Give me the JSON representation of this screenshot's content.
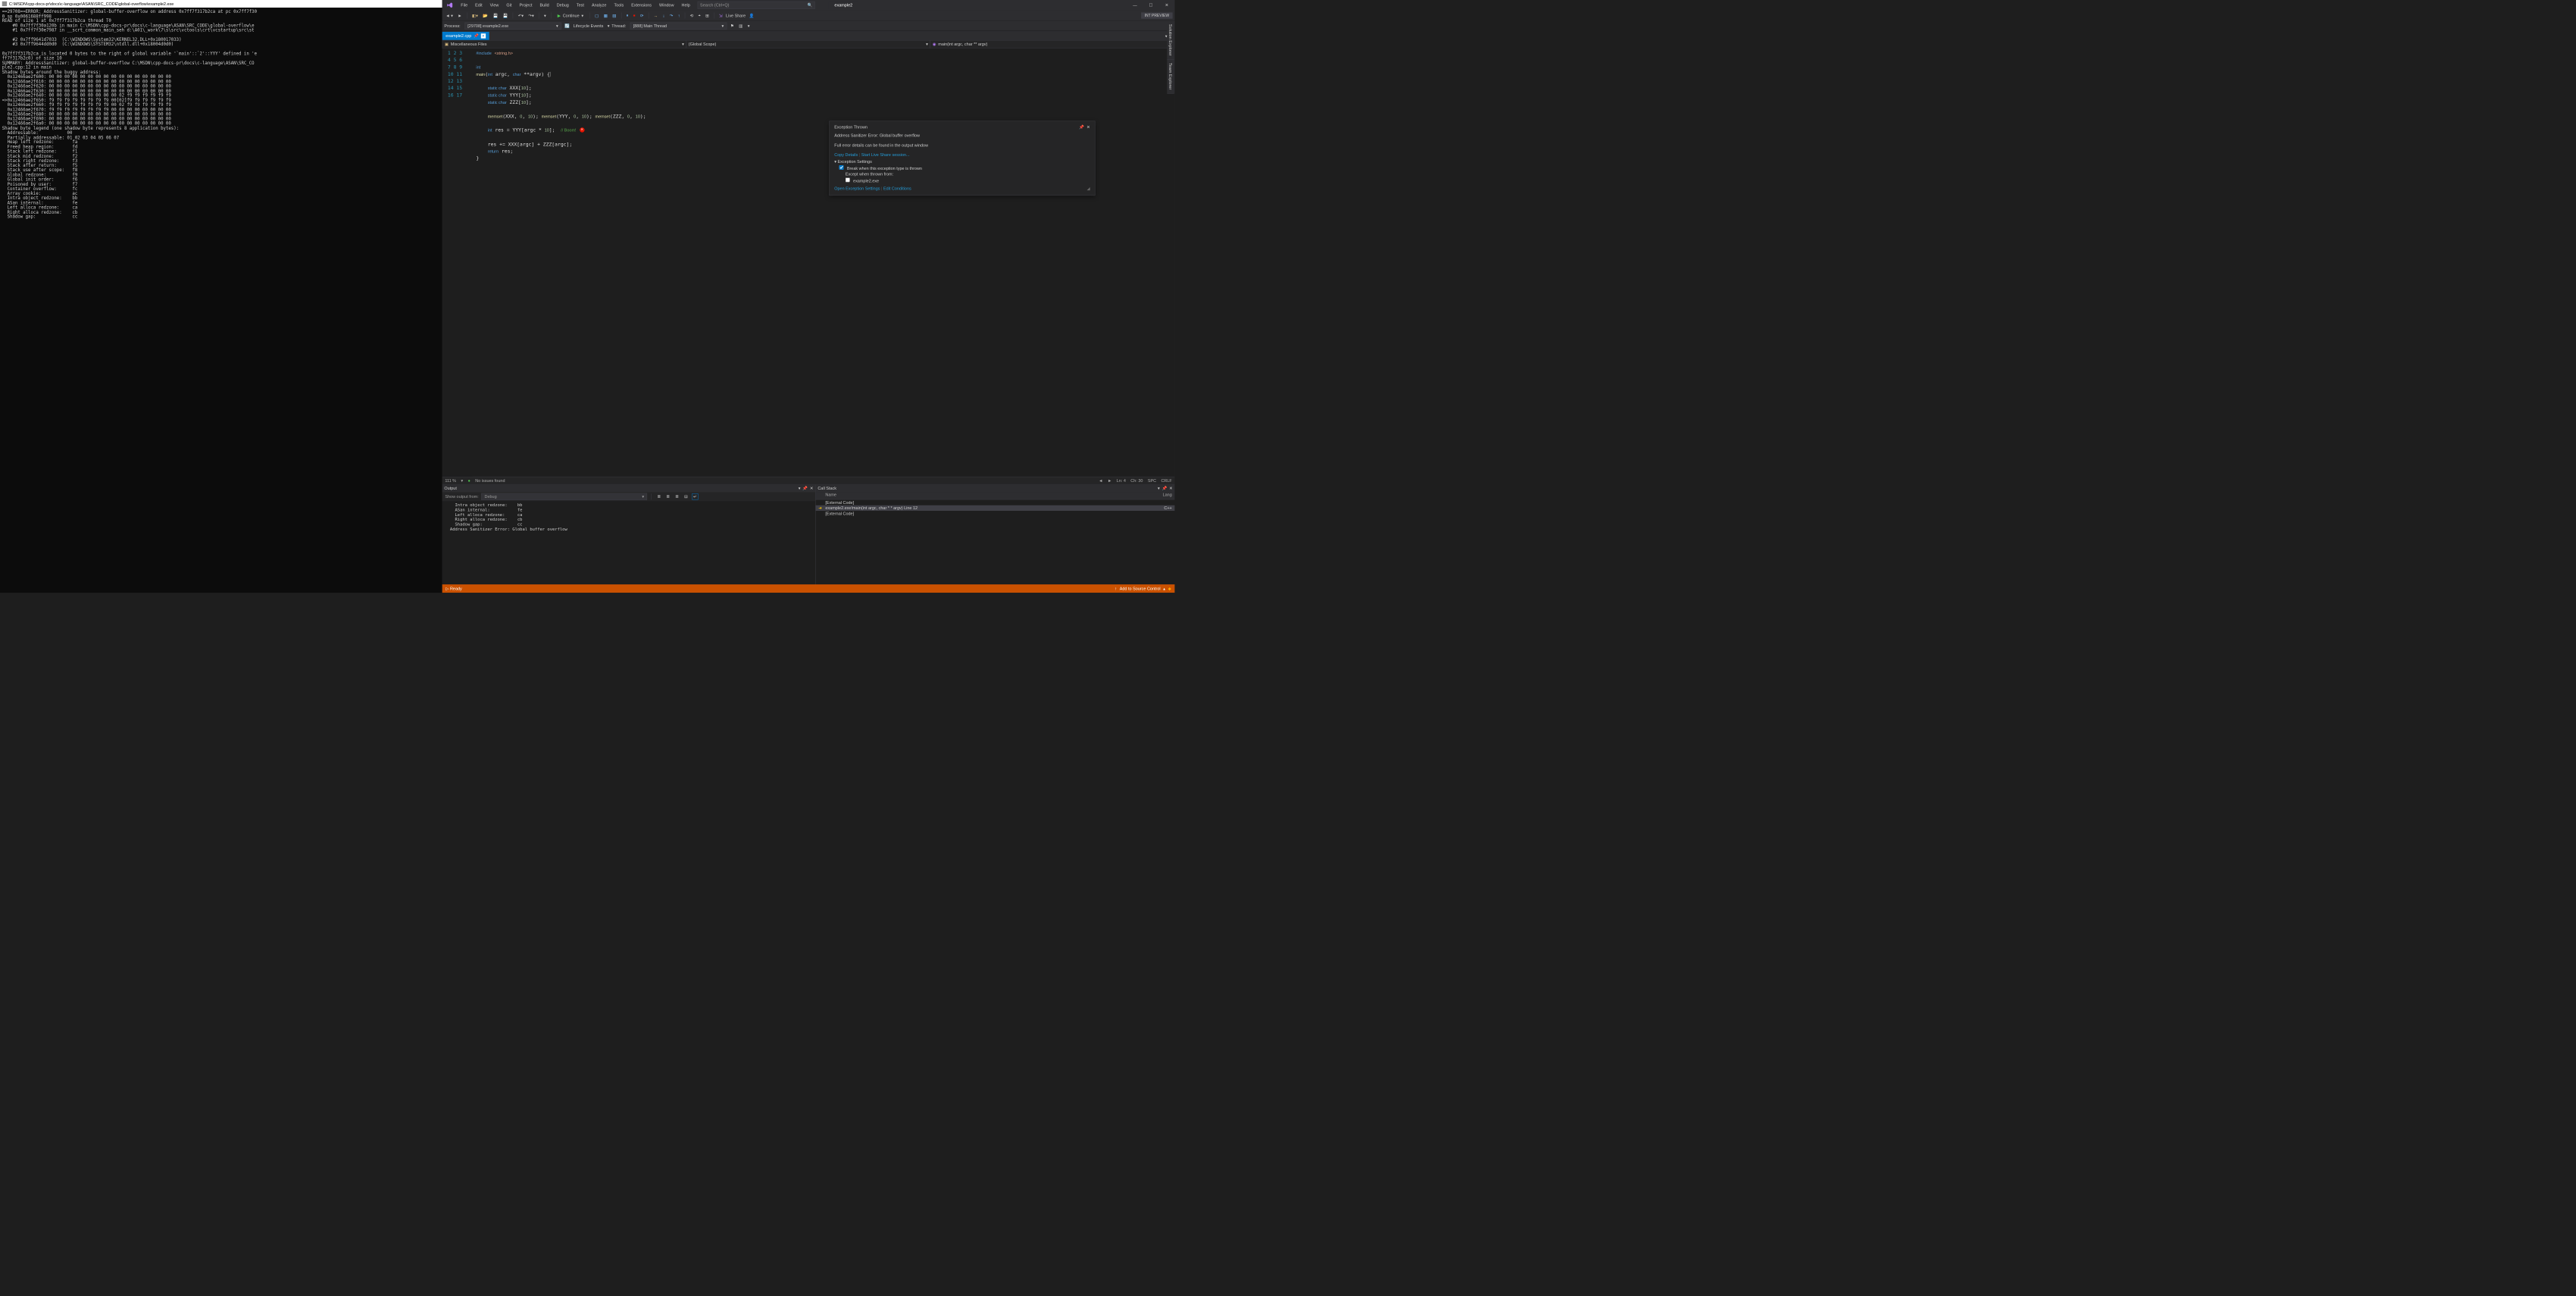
{
  "console": {
    "title": "C:\\MSDN\\cpp-docs-pr\\docs\\c-language\\ASAN\\SRC_CODE\\global-overflow\\example2.exe",
    "body": "==29708==ERROR: AddressSanitizer: global-buffer-overflow on address 0x7ff7f317b2ca at pc 0x7ff7f30\n0 sp 0x0061688ff998\nREAD of size 1 at 0x7ff7f317b2ca thread T0\n    #0 0x7ff7f30a120b in main C:\\MSDN\\cpp-docs-pr\\docs\\c-language\\ASAN\\SRC_CODE\\global-overflow\\e\n    #1 0x7ff7f30e7987 in __scrt_common_main_seh d:\\A01\\_work\\7\\s\\src\\vctools\\crt\\vcstartup\\src\\st\n\n    #2 0x7ff9641d7033  (C:\\WINDOWS\\System32\\KERNEL32.DLL+0x180017033)\n    #3 0x7ff9644dd0d0  (C:\\WINDOWS\\SYSTEM32\\ntdll.dll+0x18004d0d0)\n\n0x7ff7f317b2ca is located 0 bytes to the right of global variable '`main'::`2'::YYY' defined in 'e\nff7f317b2c0) of size 10\nSUMMARY: AddressSanitizer: global-buffer-overflow C:\\MSDN\\cpp-docs-pr\\docs\\c-language\\ASAN\\SRC_CO\nple2.cpp:12 in main\nShadow bytes around the buggy address:\n  0x12466ae2f600: 00 00 00 00 00 00 00 00 00 00 00 00 00 00 00 00\n  0x12466ae2f610: 00 00 00 00 00 00 00 00 00 00 00 00 00 00 00 00\n  0x12466ae2f620: 00 00 00 00 00 00 00 00 00 00 00 00 00 00 00 00\n  0x12466ae2f630: 00 00 00 00 00 00 00 00 00 00 00 00 00 00 00 00\n  0x12466ae2f640: 00 00 00 00 00 00 00 00 00 02 f9 f9 f9 f9 f9 f9\n=>0x12466ae2f650: f9 f9 f9 f9 f9 f9 f9 f9 00[02]f9 f9 f9 f9 f9 f9\n  0x12466ae2f660: f9 f9 f9 f9 f9 f9 f9 f9 00 02 f9 f9 f9 f9 f9 f9\n  0x12466ae2f670: f9 f9 f9 f9 f9 f9 f9 f9 00 00 00 00 00 00 00 00\n  0x12466ae2f680: 00 00 00 00 00 00 00 00 00 00 00 00 00 00 00 00\n  0x12466ae2f690: 00 00 00 00 00 00 00 00 00 00 00 00 00 00 00 00\n  0x12466ae2f6a0: 00 00 00 00 00 00 00 00 00 00 00 00 00 00 00 00\nShadow byte legend (one shadow byte represents 8 application bytes):\n  Addressable:           00\n  Partially addressable: 01 02 03 04 05 06 07\n  Heap left redzone:       fa\n  Freed heap region:       fd\n  Stack left redzone:      f1\n  Stack mid redzone:       f2\n  Stack right redzone:     f3\n  Stack after return:      f5\n  Stack use after scope:   f8\n  Global redzone:          f9\n  Global init order:       f6\n  Poisoned by user:        f7\n  Container overflow:      fc\n  Array cookie:            ac\n  Intra object redzone:    bb\n  ASan internal:           fe\n  Left alloca redzone:     ca\n  Right alloca redzone:    cb\n  Shadow gap:              cc"
  },
  "vs": {
    "menu": [
      "File",
      "Edit",
      "View",
      "Git",
      "Project",
      "Build",
      "Debug",
      "Test",
      "Analyze",
      "Tools",
      "Extensions",
      "Window",
      "Help"
    ],
    "search_placeholder": "Search (Ctrl+Q)",
    "doc_title": "example2",
    "toolbar": {
      "continue": "Continue",
      "live_share": "Live Share",
      "int_preview": "INT PREVIEW"
    },
    "toolbar2": {
      "process_lbl": "Process:",
      "process_val": "[29708] example2.exe",
      "lifecycle": "Lifecycle Events",
      "thread_lbl": "Thread:",
      "thread_val": "[888] Main Thread"
    },
    "tab": "example2.cpp",
    "nav": {
      "scope1": "Miscellaneous Files",
      "scope2": "(Global Scope)",
      "scope3": "main(int argc, char ** argv)"
    },
    "code_lines": [
      "1",
      "2",
      "3",
      "4",
      "5",
      "6",
      "7",
      "8",
      "9",
      "10",
      "11",
      "12",
      "13",
      "14",
      "15",
      "16",
      "17"
    ],
    "editor_status": {
      "zoom": "111 %",
      "issues": "No issues found",
      "ln": "Ln: 4",
      "ch": "Ch: 30",
      "spc": "SPC",
      "crlf": "CRLF"
    },
    "side_tabs": [
      "Solution Explorer",
      "Team Explorer"
    ],
    "exception": {
      "title": "Exception Thrown",
      "msg": "Address Sanitizer Error: Global buffer overflow",
      "sub": "Full error details can be found in the output window",
      "copy": "Copy Details",
      "live": "Start Live Share session...",
      "settings_hdr": "Exception Settings",
      "break": "Break when this exception type is thrown",
      "except": "Except when thrown from:",
      "exe": "example2.exe",
      "open": "Open Exception Settings",
      "edit": "Edit Conditions"
    },
    "output": {
      "title": "Output",
      "from_lbl": "Show output from:",
      "from_val": "Debug",
      "body": "    Intra object redzone:    bb\n    ASan internal:           fe\n    Left alloca redzone:     ca\n    Right alloca redzone:    cb\n    Shadow gap:              cc\n  Address Sanitizer Error: Global buffer overflow"
    },
    "callstack": {
      "title": "Call Stack",
      "cols": {
        "name": "Name",
        "lang": "Lang"
      },
      "rows": [
        {
          "ic": "",
          "name": "[External Code]",
          "lang": ""
        },
        {
          "ic": "➜",
          "name": "example2.exe!main(int argc, char * * argv) Line 12",
          "lang": "C++"
        },
        {
          "ic": "",
          "name": "[External Code]",
          "lang": ""
        }
      ]
    },
    "statusbar": {
      "ready": "Ready",
      "add": "Add to Source Control"
    }
  }
}
